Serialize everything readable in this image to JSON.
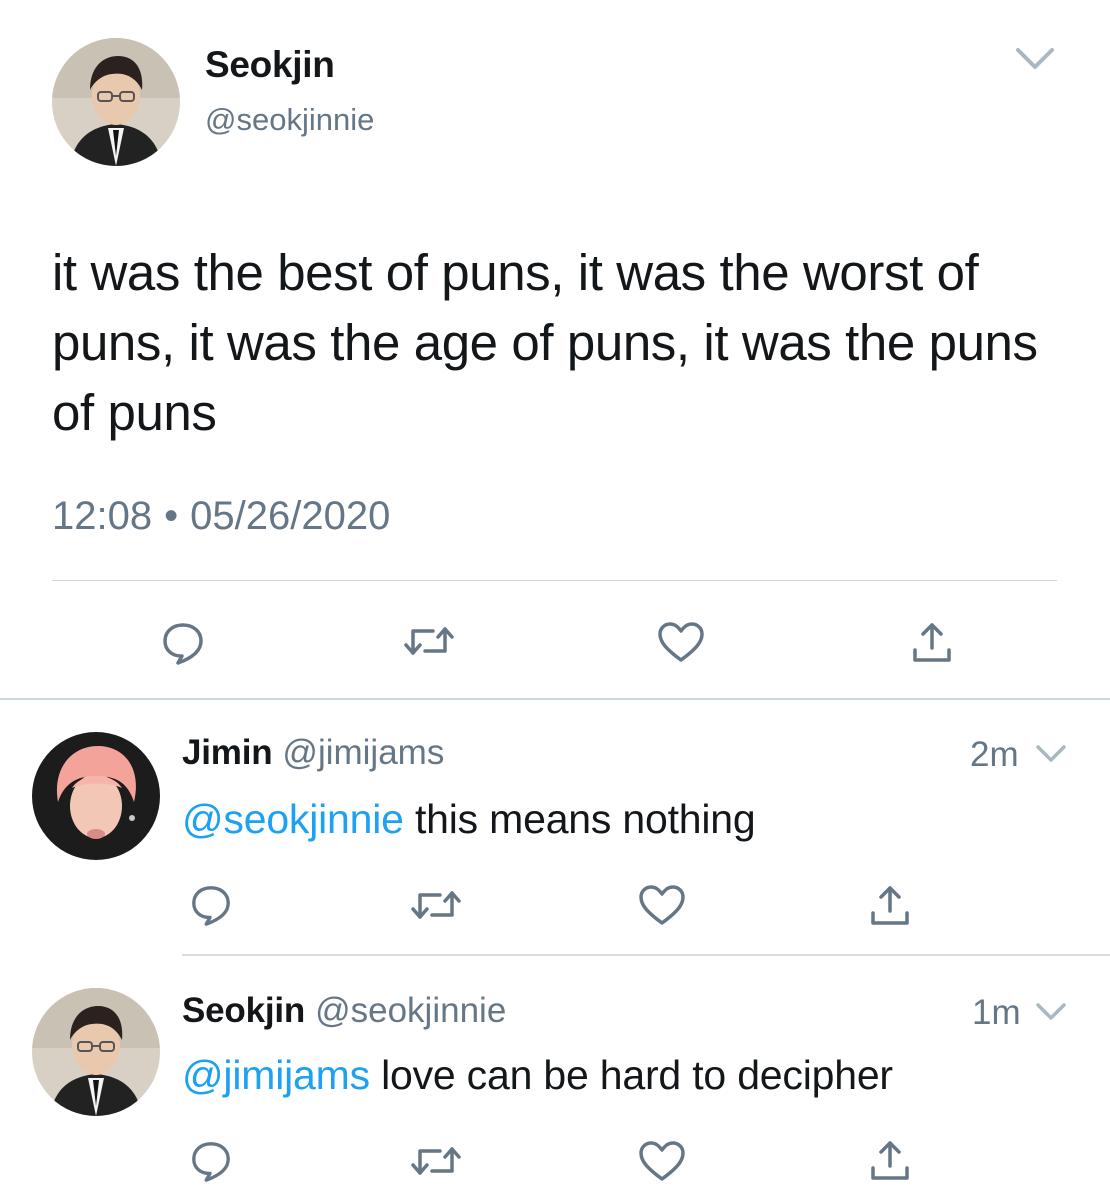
{
  "main_tweet": {
    "name": "Seokjin",
    "handle": "@seokjinnie",
    "text": "it was the best of puns, it was the worst of puns, it was the age of puns, it was the puns of puns",
    "time": "12:08",
    "separator": "•",
    "date": "05/26/2020",
    "icons": [
      "reply-icon",
      "retweet-icon",
      "like-icon",
      "share-icon",
      "chevron-down-icon"
    ]
  },
  "replies": [
    {
      "name": "Jimin",
      "handle": "@jimijams",
      "time": "2m",
      "mention": "@seokjinnie",
      "text": " this means nothing"
    },
    {
      "name": "Seokjin",
      "handle": "@seokjinnie",
      "time": "1m",
      "mention": "@jimijams",
      "text": " love can be hard to decipher"
    }
  ],
  "colors": {
    "text": "#14171a",
    "secondary": "#657786",
    "link": "#1da1f2",
    "divider": "#ccd6dd"
  }
}
